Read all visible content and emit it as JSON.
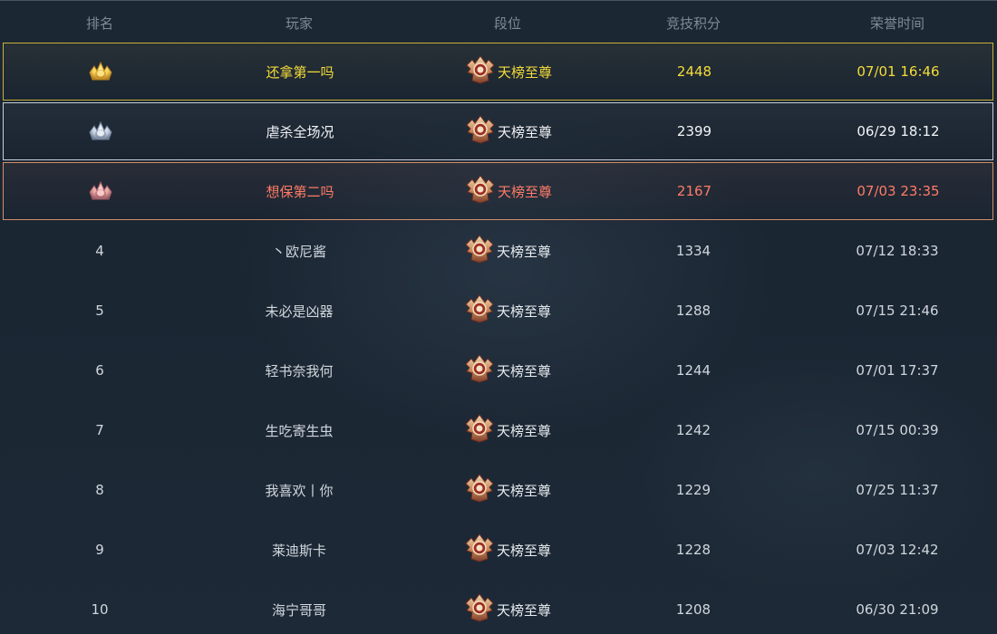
{
  "header": {
    "rank": "排名",
    "player": "玩家",
    "tier": "段位",
    "score": "竞技积分",
    "time": "荣誉时间"
  },
  "rows": [
    {
      "rank": "",
      "rank_icon": "gold-medal-icon",
      "player": "还拿第一吗",
      "tier": "天榜至尊",
      "score": "2448",
      "time": "07/01 16:46"
    },
    {
      "rank": "",
      "rank_icon": "silver-medal-icon",
      "player": "虐杀全场况",
      "tier": "天榜至尊",
      "score": "2399",
      "time": "06/29 18:12"
    },
    {
      "rank": "",
      "rank_icon": "bronze-medal-icon",
      "player": "想保第二吗",
      "tier": "天榜至尊",
      "score": "2167",
      "time": "07/03 23:35"
    },
    {
      "rank": "4",
      "player": "丶欧尼酱",
      "tier": "天榜至尊",
      "score": "1334",
      "time": "07/12 18:33"
    },
    {
      "rank": "5",
      "player": "未必是凶器",
      "tier": "天榜至尊",
      "score": "1288",
      "time": "07/15 21:46"
    },
    {
      "rank": "6",
      "player": "轻书奈我何",
      "tier": "天榜至尊",
      "score": "1244",
      "time": "07/01 17:37"
    },
    {
      "rank": "7",
      "player": "生吃寄生虫",
      "tier": "天榜至尊",
      "score": "1242",
      "time": "07/15 00:39"
    },
    {
      "rank": "8",
      "player": "我喜欢丨你",
      "tier": "天榜至尊",
      "score": "1229",
      "time": "07/25 11:37"
    },
    {
      "rank": "9",
      "player": "莱迪斯卡",
      "tier": "天榜至尊",
      "score": "1228",
      "time": "07/03 12:42"
    },
    {
      "rank": "10",
      "player": "海宁哥哥",
      "tier": "天榜至尊",
      "score": "1208",
      "time": "06/30 21:09"
    }
  ],
  "colors": {
    "gold": "#f5dc3a",
    "silver": "#f2f4f7",
    "bronze": "#ff7b67",
    "normal": "#d0d6dd",
    "header": "#7f8b98",
    "background": "#1b2633"
  },
  "tier_icon": "tier-crest-icon"
}
